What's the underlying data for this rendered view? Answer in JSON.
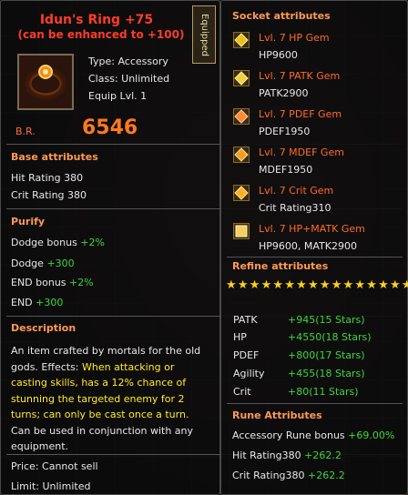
{
  "item": {
    "title": "Idun's Ring  +75",
    "enhance_note": "(can be enhanced to +100)",
    "equipped_label": "Equipped",
    "type": "Type: Accessory",
    "class": "Class: Unlimited",
    "equip_lvl": "Equip Lvl. 1",
    "br_label": "B.R.",
    "br_value": "6546"
  },
  "base": {
    "heading": "Base attributes",
    "lines": [
      "Hit Rating 380",
      "Crit Rating 380"
    ]
  },
  "purify": {
    "heading": "Purify",
    "lines": [
      {
        "label": "Dodge bonus",
        "value": "+2%"
      },
      {
        "label": "Dodge",
        "value": "+300"
      },
      {
        "label": "END bonus",
        "value": "+2%"
      },
      {
        "label": "END",
        "value": "+300"
      }
    ]
  },
  "description": {
    "heading": "Description",
    "text1": "An item crafted by mortals for the old gods. Effects: ",
    "effect": "When attacking or casting skills, has a 12% chance of stunning the targeted enemy for 2 turns; can only be cast once a turn.",
    "text2": " Can be used in conjunction with any equipment."
  },
  "price": "Price: Cannot sell",
  "limit": "Limit: Unlimited",
  "sockets": {
    "heading": "Socket attributes",
    "gems": [
      {
        "name": "Lvl. 7 HP Gem",
        "value": "HP9600",
        "color": "#e8c020"
      },
      {
        "name": "Lvl. 7 PATK Gem",
        "value": "PATK2900",
        "color": "#f0d040"
      },
      {
        "name": "Lvl. 7 PDEF Gem",
        "value": "PDEF1950",
        "color": "#ff8a30"
      },
      {
        "name": "Lvl. 7 MDEF Gem",
        "value": "MDEF1950",
        "color": "#f0a020"
      },
      {
        "name": "Lvl. 7 Crit Gem",
        "value": "Crit Rating310",
        "color": "#ffb020"
      },
      {
        "name": "Lvl. 7 HP+MATK Gem",
        "value": "HP9600, MATK2900",
        "color": "#f4d060"
      }
    ]
  },
  "refine": {
    "heading": "Refine attributes",
    "stars": "★★★★★★★★★★★★★★★★",
    "lines": [
      {
        "stat": "PATK",
        "value": "+945(15 Stars)"
      },
      {
        "stat": "HP",
        "value": "+4550(18 Stars)"
      },
      {
        "stat": "PDEF",
        "value": "+800(17 Stars)"
      },
      {
        "stat": "Agility",
        "value": "+455(18 Stars)"
      },
      {
        "stat": "Crit",
        "value": "+80(11 Stars)"
      }
    ]
  },
  "rune": {
    "heading": "Rune Attributes",
    "lines": [
      {
        "label": "Accessory Rune bonus",
        "value": "+69.00%"
      },
      {
        "label": "Hit Rating380",
        "value": "+262.2"
      },
      {
        "label": "Crit Rating380",
        "value": "+262.2"
      }
    ]
  }
}
